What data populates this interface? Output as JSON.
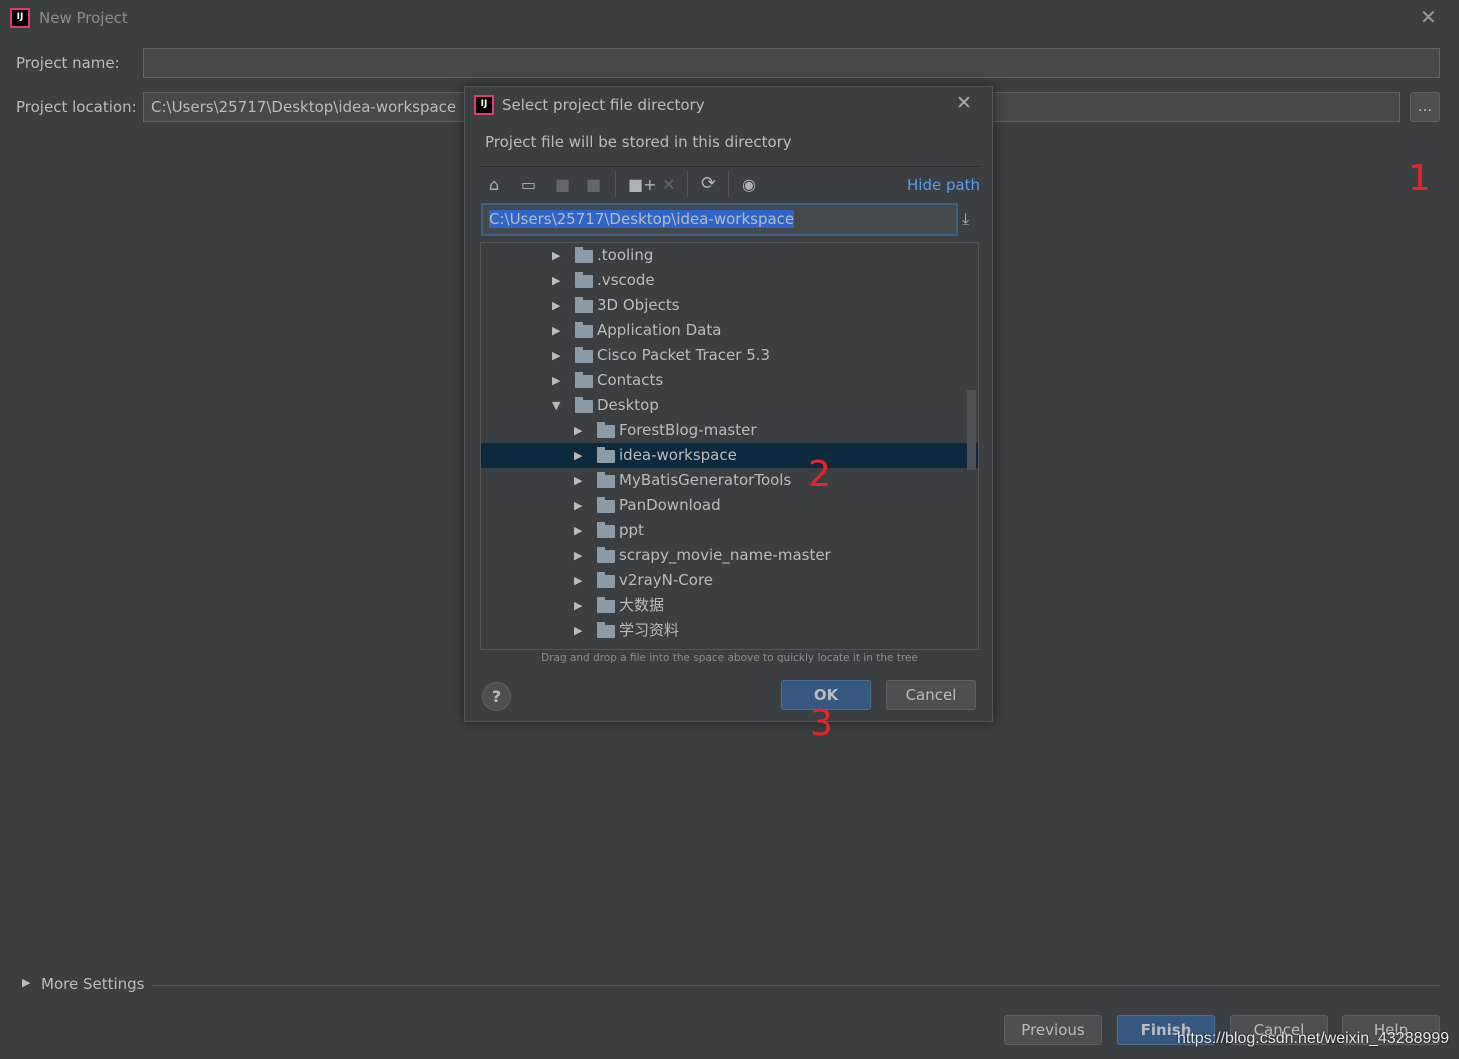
{
  "window": {
    "title": "New Project",
    "close_icon": "close-icon"
  },
  "form": {
    "project_name_label": "Project name:",
    "project_name_value": "",
    "project_location_label": "Project location:",
    "project_location_value": "C:\\Users\\25717\\Desktop\\idea-workspace",
    "browse_label": "..."
  },
  "dialog": {
    "title": "Select project file directory",
    "description": "Project file will be stored in this directory",
    "hide_path": "Hide path",
    "path_value": "C:\\Users\\25717\\Desktop\\idea-workspace",
    "toolbar": [
      "home-icon",
      "desktop-icon",
      "project-folder-icon",
      "module-folder-icon",
      "new-folder-icon",
      "delete-icon",
      "refresh-icon",
      "show-hidden-icon"
    ],
    "tree": [
      {
        "label": ".tooling",
        "level": 1,
        "expanded": false
      },
      {
        "label": ".vscode",
        "level": 1,
        "expanded": false
      },
      {
        "label": "3D Objects",
        "level": 1,
        "expanded": false
      },
      {
        "label": "Application Data",
        "level": 1,
        "expanded": false
      },
      {
        "label": "Cisco Packet Tracer 5.3",
        "level": 1,
        "expanded": false
      },
      {
        "label": "Contacts",
        "level": 1,
        "expanded": false
      },
      {
        "label": "Desktop",
        "level": 1,
        "expanded": true
      },
      {
        "label": "ForestBlog-master",
        "level": 2,
        "expanded": false
      },
      {
        "label": "idea-workspace",
        "level": 2,
        "expanded": false,
        "selected": true
      },
      {
        "label": "MyBatisGeneratorTools",
        "level": 2,
        "expanded": false
      },
      {
        "label": "PanDownload",
        "level": 2,
        "expanded": false
      },
      {
        "label": "ppt",
        "level": 2,
        "expanded": false
      },
      {
        "label": "scrapy_movie_name-master",
        "level": 2,
        "expanded": false
      },
      {
        "label": "v2rayN-Core",
        "level": 2,
        "expanded": false
      },
      {
        "label": "大数据",
        "level": 2,
        "expanded": false
      },
      {
        "label": "学习资料",
        "level": 2,
        "expanded": false
      }
    ],
    "hint": "Drag and drop a file into the space above to quickly locate it in the tree",
    "help": "?",
    "ok": "OK",
    "cancel": "Cancel"
  },
  "more_settings": "More Settings",
  "buttons": {
    "previous": "Previous",
    "finish": "Finish",
    "cancel": "Cancel",
    "help": "Help"
  },
  "annotations": [
    "1",
    "2",
    "3"
  ],
  "watermark": "https://blog.csdn.net/weixin_43288999",
  "colors": {
    "accent": "#365880",
    "link": "#589df6",
    "selection": "#0d293e",
    "annotation": "#e8242b"
  }
}
